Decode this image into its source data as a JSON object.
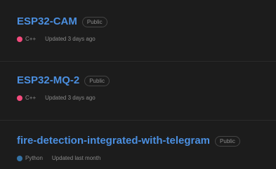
{
  "repos": [
    {
      "name": "ESP32-CAM",
      "visibility": "Public",
      "language": "C++",
      "language_color": "#f34b7d",
      "updated": "Updated 3 days ago"
    },
    {
      "name": "ESP32-MQ-2",
      "visibility": "Public",
      "language": "C++",
      "language_color": "#f34b7d",
      "updated": "Updated 3 days ago"
    },
    {
      "name": "fire-detection-integrated-with-telegram",
      "visibility": "Public",
      "language": "Python",
      "language_color": "#3572A5",
      "updated": "Updated last month"
    }
  ],
  "colors": {
    "background": "#1c1c1c",
    "link": "#4b8fe0",
    "muted": "#8a8a8a"
  }
}
